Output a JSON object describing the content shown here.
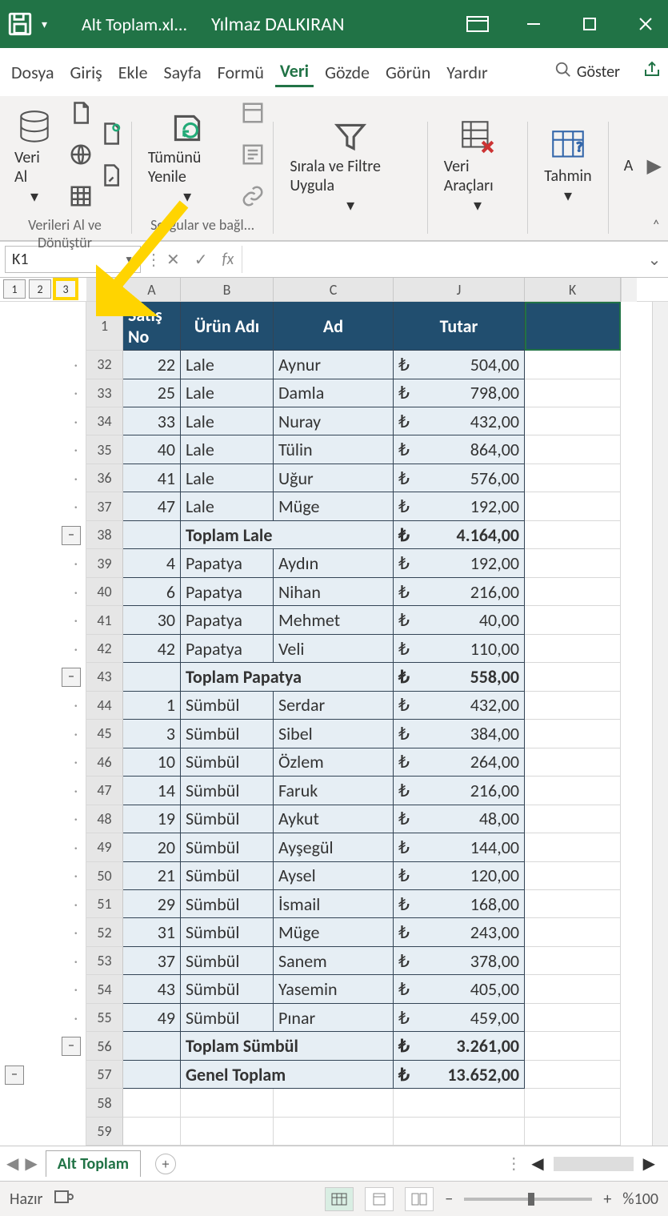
{
  "titlebar": {
    "filename": "Alt Toplam.xl...",
    "username": "Yılmaz DALKIRAN"
  },
  "tabs": [
    "Dosya",
    "Giriş",
    "Ekle",
    "Sayfa",
    "Formü",
    "Veri",
    "Gözde",
    "Görün",
    "Yardır"
  ],
  "activeTab": "Veri",
  "search_label": "Göster",
  "ribbon": {
    "group1_big": "Veri Al",
    "group1_label": "Verileri Al ve Dönüştür",
    "group2_big": "Tümünü Yenile",
    "group2_label": "Sorgular ve bağl...",
    "group3_big": "Sırala ve Filtre Uygula",
    "group4_big": "Veri Araçları",
    "group5_big": "Tahmin",
    "group6_big": "A"
  },
  "namebox": "K1",
  "fx_label": "fx",
  "outline_levels": [
    "1",
    "2",
    "3"
  ],
  "col_headers": [
    "A",
    "B",
    "C",
    "J",
    "K"
  ],
  "header_row": {
    "rownum": "1",
    "a": "Satış No",
    "b": "Ürün Adı",
    "c": "Ad",
    "j": "Tutar"
  },
  "rows": [
    {
      "n": "32",
      "a": "22",
      "b": "Lale",
      "c": "Aynur",
      "cur": "₺",
      "j": "504,00"
    },
    {
      "n": "33",
      "a": "25",
      "b": "Lale",
      "c": "Damla",
      "cur": "₺",
      "j": "798,00"
    },
    {
      "n": "34",
      "a": "33",
      "b": "Lale",
      "c": "Nuray",
      "cur": "₺",
      "j": "432,00"
    },
    {
      "n": "35",
      "a": "40",
      "b": "Lale",
      "c": "Tülin",
      "cur": "₺",
      "j": "864,00"
    },
    {
      "n": "36",
      "a": "41",
      "b": "Lale",
      "c": "Uğur",
      "cur": "₺",
      "j": "576,00"
    },
    {
      "n": "37",
      "a": "47",
      "b": "Lale",
      "c": "Müge",
      "cur": "₺",
      "j": "192,00"
    },
    {
      "n": "38",
      "a": "",
      "b": "Toplam Lale",
      "c": "",
      "cur": "₺",
      "j": "4.164,00",
      "total": true
    },
    {
      "n": "39",
      "a": "4",
      "b": "Papatya",
      "c": "Aydın",
      "cur": "₺",
      "j": "192,00"
    },
    {
      "n": "40",
      "a": "6",
      "b": "Papatya",
      "c": "Nihan",
      "cur": "₺",
      "j": "216,00"
    },
    {
      "n": "41",
      "a": "30",
      "b": "Papatya",
      "c": "Mehmet",
      "cur": "₺",
      "j": "40,00"
    },
    {
      "n": "42",
      "a": "42",
      "b": "Papatya",
      "c": "Veli",
      "cur": "₺",
      "j": "110,00"
    },
    {
      "n": "43",
      "a": "",
      "b": "Toplam Papatya",
      "c": "",
      "cur": "₺",
      "j": "558,00",
      "total": true
    },
    {
      "n": "44",
      "a": "1",
      "b": "Sümbül",
      "c": "Serdar",
      "cur": "₺",
      "j": "432,00"
    },
    {
      "n": "45",
      "a": "3",
      "b": "Sümbül",
      "c": "Sibel",
      "cur": "₺",
      "j": "384,00"
    },
    {
      "n": "46",
      "a": "10",
      "b": "Sümbül",
      "c": "Özlem",
      "cur": "₺",
      "j": "264,00"
    },
    {
      "n": "47",
      "a": "14",
      "b": "Sümbül",
      "c": "Faruk",
      "cur": "₺",
      "j": "216,00"
    },
    {
      "n": "48",
      "a": "19",
      "b": "Sümbül",
      "c": "Aykut",
      "cur": "₺",
      "j": "48,00"
    },
    {
      "n": "49",
      "a": "20",
      "b": "Sümbül",
      "c": "Ayşegül",
      "cur": "₺",
      "j": "144,00"
    },
    {
      "n": "50",
      "a": "21",
      "b": "Sümbül",
      "c": "Aysel",
      "cur": "₺",
      "j": "120,00"
    },
    {
      "n": "51",
      "a": "29",
      "b": "Sümbül",
      "c": "İsmail",
      "cur": "₺",
      "j": "168,00"
    },
    {
      "n": "52",
      "a": "31",
      "b": "Sümbül",
      "c": "Müge",
      "cur": "₺",
      "j": "243,00"
    },
    {
      "n": "53",
      "a": "37",
      "b": "Sümbül",
      "c": "Sanem",
      "cur": "₺",
      "j": "378,00"
    },
    {
      "n": "54",
      "a": "43",
      "b": "Sümbül",
      "c": "Yasemin",
      "cur": "₺",
      "j": "405,00"
    },
    {
      "n": "55",
      "a": "49",
      "b": "Sümbül",
      "c": "Pınar",
      "cur": "₺",
      "j": "459,00"
    },
    {
      "n": "56",
      "a": "",
      "b": "Toplam Sümbül",
      "c": "",
      "cur": "₺",
      "j": "3.261,00",
      "total": true
    },
    {
      "n": "57",
      "a": "",
      "b": "Genel Toplam",
      "c": "",
      "cur": "₺",
      "j": "13.652,00",
      "total": true
    },
    {
      "n": "58",
      "a": "",
      "b": "",
      "c": "",
      "cur": "",
      "j": "",
      "blank": true
    },
    {
      "n": "59",
      "a": "",
      "b": "",
      "c": "",
      "cur": "",
      "j": "",
      "blank": true
    }
  ],
  "outline_marks": {
    "dots": [
      "32",
      "33",
      "34",
      "35",
      "36",
      "37",
      "39",
      "40",
      "41",
      "42",
      "44",
      "45",
      "46",
      "47",
      "48",
      "49",
      "50",
      "51",
      "52",
      "53",
      "54",
      "55"
    ],
    "minus_inner": [
      "38",
      "43",
      "56"
    ],
    "minus_outer": [
      "57"
    ]
  },
  "sheet_tab": "Alt Toplam",
  "status": {
    "ready": "Hazır",
    "zoom": "%100"
  }
}
